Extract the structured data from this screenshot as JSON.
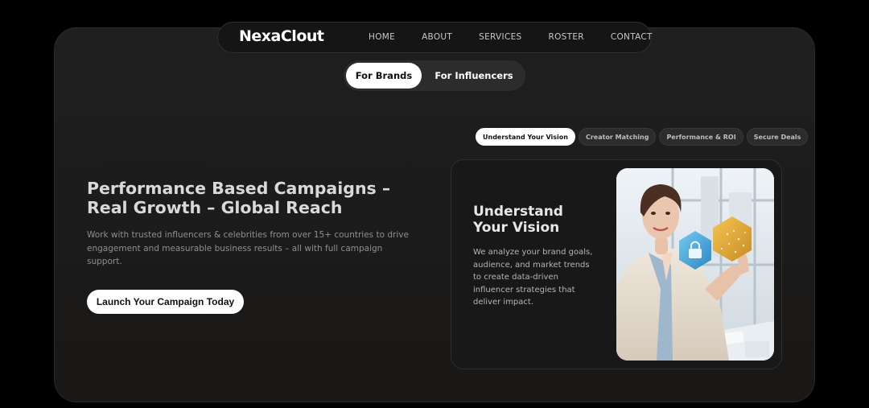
{
  "brand": {
    "logo": "NexaClout"
  },
  "nav": {
    "items": [
      {
        "label": "HOME"
      },
      {
        "label": "ABOUT"
      },
      {
        "label": "SERVICES"
      },
      {
        "label": "ROSTER"
      },
      {
        "label": "CONTACT"
      }
    ]
  },
  "audience_toggle": {
    "options": [
      {
        "label": "For Brands",
        "selected": true
      },
      {
        "label": "For Influencers",
        "selected": false
      }
    ]
  },
  "hero": {
    "title": "Performance Based Campaigns – Real Growth – Global Reach",
    "description": "Work with trusted influencers & celebrities from over 15+ countries to drive engagement and measurable business results – all with full campaign support.",
    "cta_label": "Launch Your Campaign Today"
  },
  "feature_tabs": [
    {
      "label": "Understand Your Vision",
      "active": true
    },
    {
      "label": "Creator Matching",
      "active": false
    },
    {
      "label": "Performance & ROI",
      "active": false
    },
    {
      "label": "Secure Deals",
      "active": false
    }
  ],
  "feature_card": {
    "title": "Understand Your Vision",
    "description": "We analyze your brand goals, audience, and market trends to create data-driven influencer strategies that deliver impact.",
    "image_icon": "businesswoman-holographic-lock-image"
  },
  "colors": {
    "background": "#000000",
    "panel": "#1f1f1f",
    "accent_white": "#ffffff",
    "muted_text": "#8f8f8f"
  }
}
